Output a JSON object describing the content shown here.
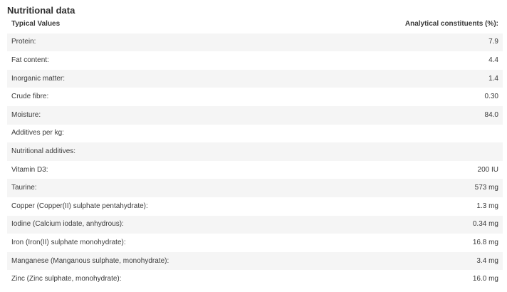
{
  "section_title": "Nutritional data",
  "table": {
    "header": {
      "left": "Typical Values",
      "right": "Analytical constituents (%):"
    },
    "rows": [
      {
        "label": "Protein:",
        "value": "7.9"
      },
      {
        "label": "Fat content:",
        "value": "4.4"
      },
      {
        "label": "Inorganic matter:",
        "value": "1.4"
      },
      {
        "label": "Crude fibre:",
        "value": "0.30"
      },
      {
        "label": "Moisture:",
        "value": "84.0"
      },
      {
        "label": "Additives per kg:",
        "value": ""
      },
      {
        "label": "Nutritional additives:",
        "value": ""
      },
      {
        "label": "Vitamin D3:",
        "value": "200 IU"
      },
      {
        "label": "Taurine:",
        "value": "573 mg"
      },
      {
        "label": "Copper (Copper(II) sulphate pentahydrate):",
        "value": "1.3 mg"
      },
      {
        "label": "Iodine (Calcium iodate, anhydrous):",
        "value": "0.34 mg"
      },
      {
        "label": "Iron (Iron(II) sulphate monohydrate):",
        "value": "16.8 mg"
      },
      {
        "label": "Manganese (Manganous sulphate, monohydrate):",
        "value": "3.4 mg"
      },
      {
        "label": "Zinc (Zinc sulphate, monohydrate):",
        "value": "16.0 mg"
      }
    ]
  },
  "colors": {
    "background": "#ffffff",
    "shaded_row": "#f5f5f5",
    "text": "#3b3b3b"
  }
}
